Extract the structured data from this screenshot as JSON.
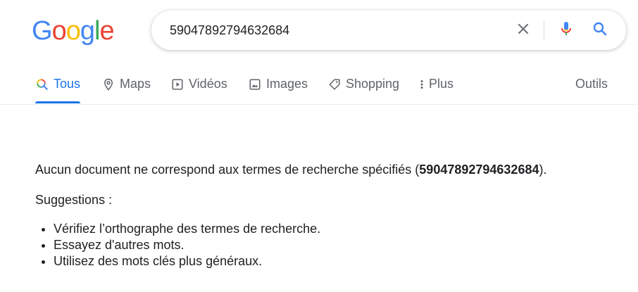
{
  "logo": {
    "letters": [
      {
        "char": "G",
        "color": "#4285F4"
      },
      {
        "char": "o",
        "color": "#EA4335"
      },
      {
        "char": "o",
        "color": "#FBBC05"
      },
      {
        "char": "g",
        "color": "#4285F4"
      },
      {
        "char": "l",
        "color": "#34A853"
      },
      {
        "char": "e",
        "color": "#EA4335"
      }
    ]
  },
  "search": {
    "query": "59047892794632684",
    "icons": {
      "clear": "close-icon",
      "voice": "microphone-icon",
      "submit": "search-icon"
    }
  },
  "tabs": [
    {
      "label": "Tous",
      "icon": "search-icon",
      "active": true
    },
    {
      "label": "Maps",
      "icon": "map-pin-icon",
      "active": false
    },
    {
      "label": "Vidéos",
      "icon": "play-icon",
      "active": false
    },
    {
      "label": "Images",
      "icon": "image-icon",
      "active": false
    },
    {
      "label": "Shopping",
      "icon": "tag-icon",
      "active": false
    },
    {
      "label": "Plus",
      "icon": "more-vert-icon",
      "active": false
    }
  ],
  "tools_label": "Outils",
  "results": {
    "no_result_prefix": "Aucun document ne correspond aux termes de recherche spécifiés (",
    "no_result_query": "59047892794632684",
    "no_result_suffix": ").",
    "suggestions_title": "Suggestions :",
    "suggestions": [
      "Vérifiez l’orthographe des termes de recherche.",
      "Essayez d'autres mots.",
      "Utilisez des mots clés plus généraux."
    ]
  },
  "colors": {
    "accent": "#1a73e8",
    "tab_text": "#5f6368",
    "body_text": "#202124",
    "mic_blue": "#4285F4",
    "mic_red": "#EA4335",
    "mic_yellow": "#FBBC05",
    "mic_green": "#34A853"
  }
}
